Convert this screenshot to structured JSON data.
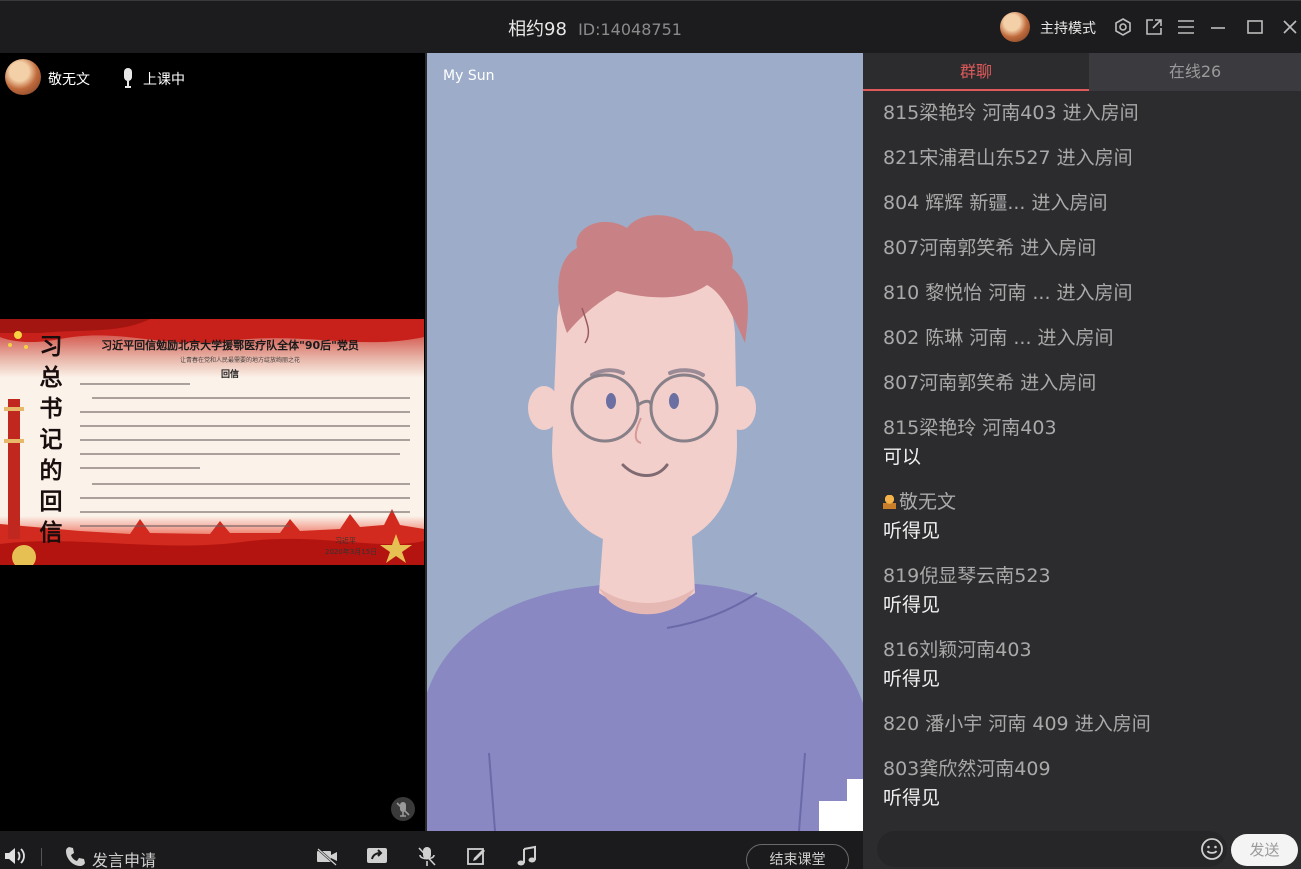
{
  "titlebar": {
    "room_name": "相约98",
    "room_id": "ID:14048751",
    "host_mode": "主持模式",
    "icons": [
      "settings-icon",
      "popout-icon",
      "menu-icon",
      "minimize-icon",
      "maximize-icon",
      "close-icon"
    ]
  },
  "teacher": {
    "name": "敬无文",
    "status": "上课中"
  },
  "slide": {
    "left_text": "习总书记的回信",
    "title": "习近平回信勉励北京大学援鄂医疗队全体\"90后\"党员",
    "subtitle": "让青春在党和人民最需要的地方绽放绚丽之花",
    "reply_label": "回信",
    "signature": "习近平",
    "date": "2020年3月15日"
  },
  "video": {
    "participant_name": "My Sun"
  },
  "chat": {
    "tab_group": "群聊",
    "tab_online": "在线26",
    "entries": [
      {
        "sender": "815梁艳玲 河南403 进入房间"
      },
      {
        "sender": "821宋浦君山东527 进入房间"
      },
      {
        "sender": "804    辉辉   新疆... 进入房间"
      },
      {
        "sender": "807河南郭笑希 进入房间"
      },
      {
        "sender": "810  黎悦怡  河南   ... 进入房间"
      },
      {
        "sender": "802    陈琳   河南 ... 进入房间"
      },
      {
        "sender": "807河南郭笑希 进入房间"
      },
      {
        "sender": "815梁艳玲 河南403",
        "message": "可以"
      },
      {
        "sender": "敬无文",
        "message": "听得见",
        "is_teacher": true
      },
      {
        "sender": "819倪显琴云南523",
        "message": "听得见"
      },
      {
        "sender": "816刘颖河南403",
        "message": "听得见"
      },
      {
        "sender": "820 潘小宇 河南 409 进入房间"
      },
      {
        "sender": "803龚欣然河南409",
        "message": "听得见"
      }
    ],
    "send_label": "发送"
  },
  "toolbar": {
    "speak_request": "发言申请",
    "end_class": "结束课堂"
  },
  "colors": {
    "accent": "#e05a5a",
    "chat_bg": "#2c2c2e",
    "video_bg": "#9dadc9"
  }
}
